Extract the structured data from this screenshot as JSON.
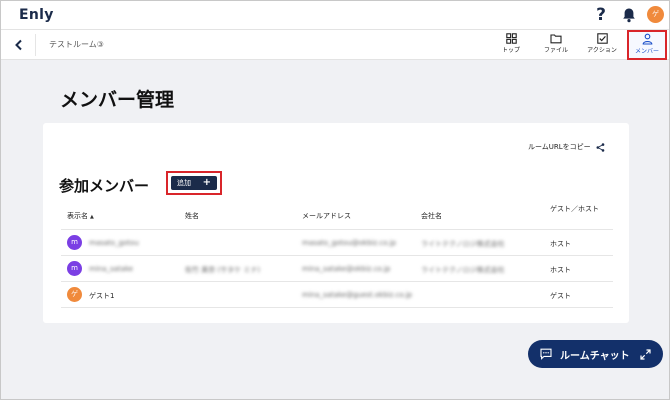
{
  "header": {
    "logo": "Enly",
    "help_glyph": "?",
    "avatar_initial": "ゲ"
  },
  "subheader": {
    "room_name": "テストルーム③",
    "nav": [
      {
        "label": "トップ",
        "icon": "grid-icon"
      },
      {
        "label": "ファイル",
        "icon": "folder-icon"
      },
      {
        "label": "アクション",
        "icon": "checkbox-icon"
      },
      {
        "label": "メンバー",
        "icon": "person-icon",
        "active": true
      }
    ]
  },
  "page": {
    "title": "メンバー管理",
    "copy_url_label": "ルームURLをコピー",
    "section_title": "参加メンバー",
    "add_label": "追加",
    "add_glyph": "+"
  },
  "table": {
    "headers": {
      "display_name": "表示名",
      "full_name": "姓名",
      "email": "メールアドレス",
      "company": "会社名",
      "guest_host": "ゲスト／ホスト"
    },
    "rows": [
      {
        "avatar": "m",
        "avatar_color": "#7b3fe4",
        "display_name": "masato_gotou",
        "full_name": "",
        "email": "masato_gotou@okbiz.co.jp",
        "company": "ライトテクノロジ株式会社",
        "role": "ホスト"
      },
      {
        "avatar": "m",
        "avatar_color": "#7b3fe4",
        "display_name": "mina_satake",
        "full_name": "佐竹 美奈 (サタケ ミナ)",
        "email": "mina_satake@okbiz.co.jp",
        "company": "ライトテクノロジ株式会社",
        "role": "ホスト"
      },
      {
        "avatar": "ゲ",
        "avatar_color": "#f08a3c",
        "display_name": "ゲスト1",
        "full_name": "",
        "email": "mina_satake@guest.okbiz.co.jp",
        "company": "",
        "role": "ゲスト"
      }
    ]
  },
  "chat": {
    "label": "ルームチャット"
  },
  "colors": {
    "navy": "#1b2b4a",
    "chat_navy": "#13306a",
    "highlight_red": "#d9252a",
    "avatar_purple": "#7b3fe4",
    "avatar_orange": "#f08a3c"
  }
}
